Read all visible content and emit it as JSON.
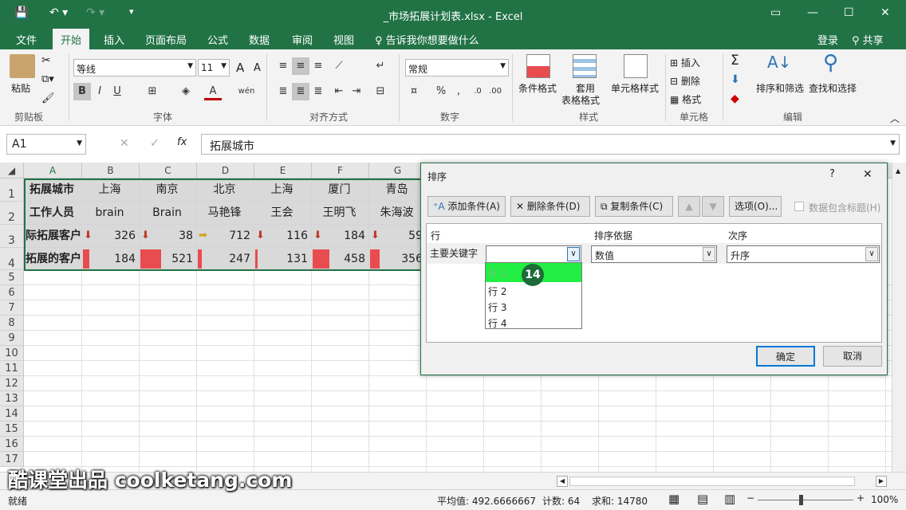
{
  "window": {
    "title": "_市场拓展计划表.xlsx - Excel"
  },
  "tabs": [
    "文件",
    "开始",
    "插入",
    "页面布局",
    "公式",
    "数据",
    "审阅",
    "视图"
  ],
  "tell_me": "告诉我你想要做什么",
  "account": {
    "login": "登录",
    "share": "共享"
  },
  "ribbon": {
    "paste": "粘贴",
    "font_name": "等线",
    "font_size": "11",
    "font_size_up": "A",
    "font_size_down": "A",
    "bold": "B",
    "italic": "I",
    "underline": "U",
    "font_color": "A",
    "phonetic": "wén",
    "number_format": "常规",
    "percent": "%",
    "comma": ",",
    "cond_format": "条件格式",
    "table_format": "套用",
    "table_format2": "表格格式",
    "cell_styles": "单元格样式",
    "insert": "插入",
    "delete": "删除",
    "format": "格式",
    "sum": "Σ",
    "sort_filter": "排序和筛选",
    "find_select": "查找和选择",
    "groups": [
      "剪贴板",
      "字体",
      "对齐方式",
      "数字",
      "样式",
      "单元格",
      "编辑"
    ]
  },
  "formula_bar": {
    "name_box": "A1",
    "fx": "fx",
    "value": "拓展城市"
  },
  "sheet": {
    "col_headers": [
      "A",
      "B",
      "C",
      "D",
      "E",
      "F",
      "G"
    ],
    "row_headers": [
      "1",
      "2",
      "3",
      "4",
      "5",
      "6",
      "7",
      "8",
      "9",
      "10",
      "11",
      "12",
      "13",
      "14",
      "15",
      "16",
      "17"
    ],
    "row1": [
      "拓展城市",
      "上海",
      "南京",
      "北京",
      "上海",
      "厦门",
      "青岛"
    ],
    "row2": [
      "工作人员",
      "brain",
      "Brain",
      "马艳锋",
      "王会",
      "王明飞",
      "朱海波"
    ],
    "row3_label": "际拓展客户",
    "row3": [
      "326",
      "38",
      "712",
      "116",
      "184",
      "59"
    ],
    "row4_label": "拓展的客户",
    "row4": [
      "184",
      "521",
      "247",
      "131",
      "458",
      "356"
    ],
    "bar_fractions": [
      0.3,
      1.0,
      0.2,
      0.0,
      0.8,
      0.45
    ]
  },
  "dialog": {
    "title": "排序",
    "help": "?",
    "close": "✕",
    "add": "添加条件(A)",
    "remove": "删除条件(D)",
    "copy": "复制条件(C)",
    "options": "选项(O)...",
    "has_header": "数据包含标题(H)",
    "col_row": "行",
    "col_sort_on": "排序依据",
    "col_order": "次序",
    "key_label": "主要关键字",
    "sort_on_value": "数值",
    "order_value": "升序",
    "dropdown": [
      "行 1",
      "行 2",
      "行 3",
      "行 4"
    ],
    "step_badge": "14",
    "ok": "确定",
    "cancel": "取消"
  },
  "status": {
    "ready": "就绪",
    "average": "平均值: 492.6666667",
    "count": "计数: 64",
    "sum": "求和: 14780",
    "zoom": "100%"
  },
  "watermark": "酷课堂出品 coolketang.com",
  "colors": {
    "accent": "#217346",
    "highlight": "#22ee44",
    "badge": "#1e6b3a",
    "bar": "#e84c4f"
  }
}
